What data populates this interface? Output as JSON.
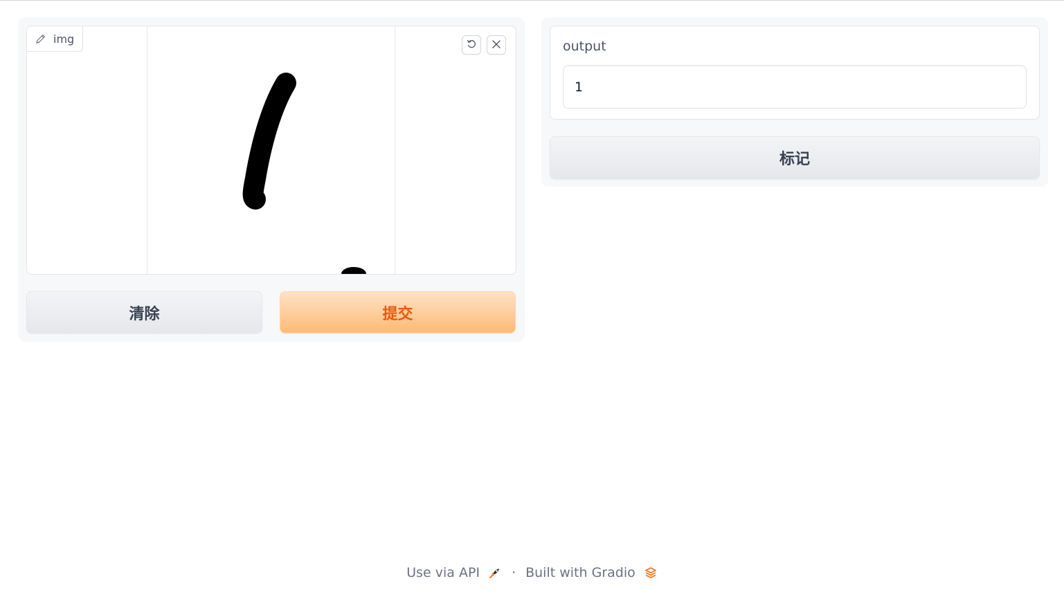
{
  "sketchpad": {
    "label": "img",
    "icons": {
      "label_icon": "pencil-icon",
      "undo": "undo-icon",
      "clear": "close-icon"
    }
  },
  "buttons": {
    "clear_label": "清除",
    "submit_label": "提交",
    "flag_label": "标记"
  },
  "output": {
    "label": "output",
    "value": "1"
  },
  "footer": {
    "api_text": "Use via API",
    "separator": "·",
    "built_text": "Built with Gradio",
    "api_icon": "rocket-icon",
    "gradio_icon": "gradio-logo-icon"
  },
  "colors": {
    "primary_text": "#ea580c",
    "primary_bg": "#fdba74",
    "secondary_bg": "#e5e7eb",
    "panel_bg": "#f7f8fa"
  }
}
